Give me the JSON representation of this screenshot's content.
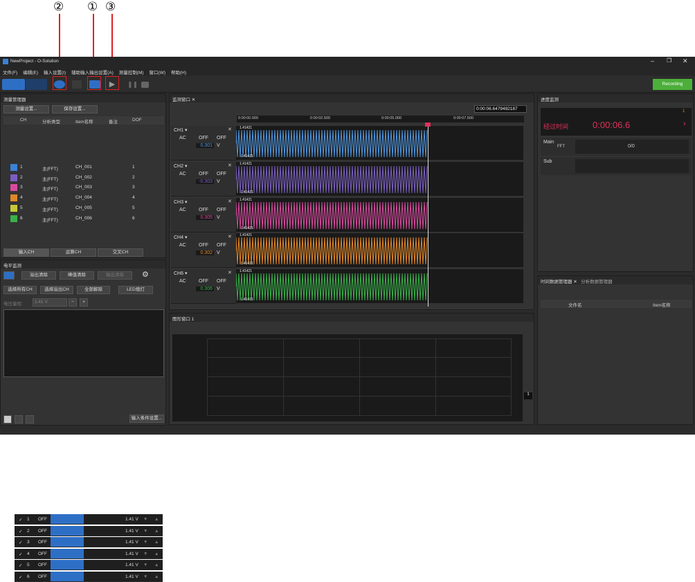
{
  "callouts": {
    "c2": "②",
    "c1": "①",
    "c3": "③"
  },
  "app": {
    "title": "NewProject - O-Solution",
    "menu": [
      "文件(F)",
      "编辑(E)",
      "输入设置(I)",
      "辅助输入输出设置(A)",
      "测量控制(M)",
      "窗口(W)",
      "帮助(H)"
    ],
    "recording": "Recording",
    "meas_manager": {
      "title": "测量管理器",
      "btn_settings": "测量设置...",
      "btn_save": "保存设置...",
      "headers": [
        "CH",
        "分析类型",
        "Item名称",
        "备注",
        "DOF"
      ],
      "rows": [
        {
          "ch": "1",
          "type": "主(FFT)",
          "item": "CH_001",
          "dof": "1",
          "color": "#3a82d6"
        },
        {
          "ch": "2",
          "type": "主(FFT)",
          "item": "CH_002",
          "dof": "2",
          "color": "#7b5fc0"
        },
        {
          "ch": "3",
          "type": "主(FFT)",
          "item": "CH_003",
          "dof": "3",
          "color": "#d64a9e"
        },
        {
          "ch": "4",
          "type": "主(FFT)",
          "item": "CH_004",
          "dof": "4",
          "color": "#e0872a"
        },
        {
          "ch": "5",
          "type": "主(FFT)",
          "item": "CH_005",
          "dof": "5",
          "color": "#c8c83a"
        },
        {
          "ch": "6",
          "type": "主(FFT)",
          "item": "CH_006",
          "dof": "6",
          "color": "#3ab04a"
        }
      ],
      "tabs": [
        "输入CH",
        "运算CH",
        "交叉CH"
      ]
    },
    "level_monitor": {
      "title": "电平监测",
      "b1": "溢出清除",
      "b2": "峰值清除",
      "b3": "输出清除",
      "b4": "选择所有CH",
      "b5": "选择溢出CH",
      "b6": "全部解除",
      "b7": "LED熄灯",
      "range_label": "电压量程:",
      "range_value": "1.41 V",
      "rows": [
        {
          "n": "1",
          "s": "OFF",
          "v": "1.41 V"
        },
        {
          "n": "2",
          "s": "OFF",
          "v": "1.41 V"
        },
        {
          "n": "3",
          "s": "OFF",
          "v": "1.41 V"
        },
        {
          "n": "4",
          "s": "OFF",
          "v": "1.41 V"
        },
        {
          "n": "5",
          "s": "OFF",
          "v": "1.41 V"
        },
        {
          "n": "6",
          "s": "OFF",
          "v": "1.41 V"
        }
      ],
      "footer_btn": "输入条件设置..."
    },
    "monitor": {
      "title": "监测窗口",
      "time": "0:00:06.6479492187",
      "ticks": [
        "0:00:00.000",
        "0:00:02.500",
        "0:00:05.000",
        "0:00:07.500"
      ],
      "channels": [
        {
          "name": "CH1",
          "ac": "AC",
          "off1": "OFF",
          "off2": "OFF",
          "val": "0.301",
          "unit": "V",
          "color": "#4f95dc",
          "hi": "1.41421",
          "lo": "-1.41421"
        },
        {
          "name": "CH2",
          "ac": "AC",
          "off1": "OFF",
          "off2": "OFF",
          "val": "-0.303",
          "unit": "V",
          "color": "#7b5fc0",
          "hi": "1.41421",
          "lo": "-1.41421"
        },
        {
          "name": "CH3",
          "ac": "AC",
          "off1": "OFF",
          "off2": "OFF",
          "val": "0.305",
          "unit": "V",
          "color": "#d64a9e",
          "hi": "1.41421",
          "lo": "-1.41421"
        },
        {
          "name": "CH4",
          "ac": "AC",
          "off1": "OFF",
          "off2": "OFF",
          "val": "0.302",
          "unit": "V",
          "color": "#e0872a",
          "hi": "1.41421",
          "lo": "-1.41421"
        },
        {
          "name": "CH6",
          "ac": "AC",
          "off1": "OFF",
          "off2": "OFF",
          "val": "0.306",
          "unit": "V",
          "color": "#3ab04a",
          "hi": "1.41421",
          "lo": "-1.41421"
        }
      ]
    },
    "graph": {
      "title": "图形窗口 1",
      "page": "1"
    },
    "progress": {
      "title": "进度监测",
      "elapsed_label": "经过时间",
      "elapsed": "0:00:06.6",
      "badge": "1",
      "main": "Main",
      "fft": "FFT",
      "count": "0/0",
      "sub": "Sub"
    },
    "data_mgr": {
      "tab1": "时间数据管理器",
      "tab2": "分析数据管理器",
      "col1": "文件名",
      "col2": "Item名称"
    }
  }
}
